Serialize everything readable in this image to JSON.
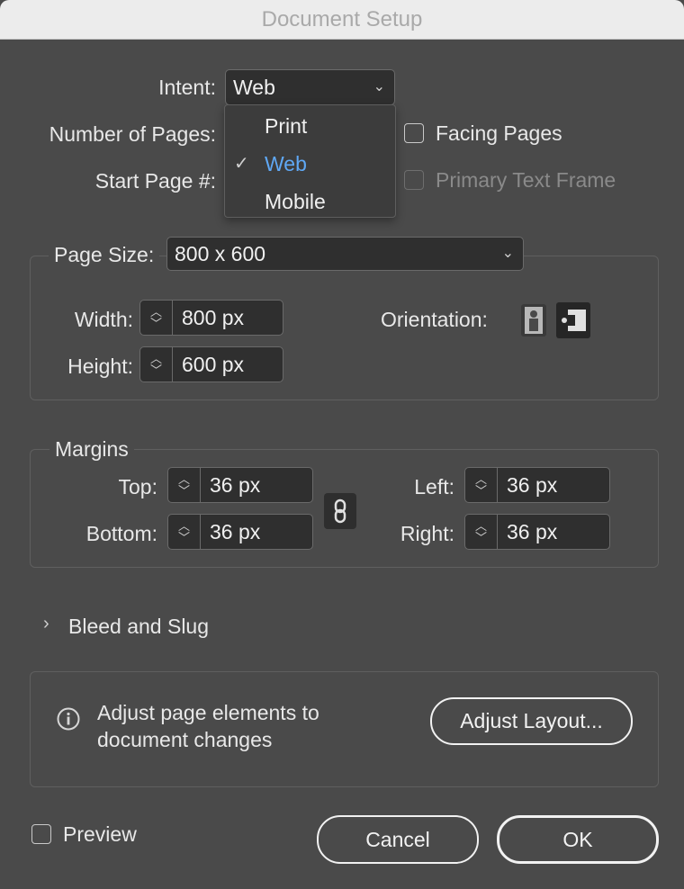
{
  "window": {
    "title": "Document Setup"
  },
  "intent": {
    "label": "Intent:",
    "value": "Web",
    "options": [
      {
        "label": "Print",
        "selected": false
      },
      {
        "label": "Web",
        "selected": true
      },
      {
        "label": "Mobile",
        "selected": false
      }
    ]
  },
  "pages": {
    "number_label": "Number of Pages:",
    "start_label": "Start Page #:"
  },
  "facing_pages": {
    "label": "Facing Pages",
    "checked": false
  },
  "primary_text_frame": {
    "label": "Primary Text Frame",
    "checked": false,
    "disabled": true
  },
  "page_size": {
    "label": "Page Size:",
    "value": "800 x 600",
    "width_label": "Width:",
    "width_value": "800 px",
    "height_label": "Height:",
    "height_value": "600 px",
    "orientation_label": "Orientation:",
    "orientation_selected": "landscape"
  },
  "margins": {
    "title": "Margins",
    "top_label": "Top:",
    "top_value": "36 px",
    "bottom_label": "Bottom:",
    "bottom_value": "36 px",
    "left_label": "Left:",
    "left_value": "36 px",
    "right_label": "Right:",
    "right_value": "36 px"
  },
  "bleed": {
    "label": "Bleed and Slug",
    "expanded": false
  },
  "adjust": {
    "text_line1": "Adjust page elements to",
    "text_line2": "document changes",
    "button": "Adjust Layout..."
  },
  "preview": {
    "label": "Preview",
    "checked": false
  },
  "actions": {
    "cancel": "Cancel",
    "ok": "OK"
  },
  "colors": {
    "accent": "#5fa8f5",
    "background": "#4a4a4a",
    "field": "#2f2f2f"
  }
}
